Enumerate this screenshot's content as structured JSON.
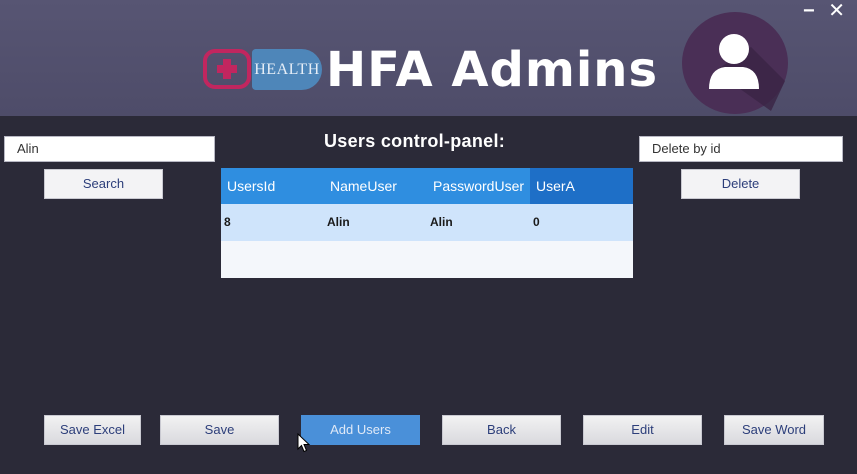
{
  "window": {
    "minimize_glyph": "−",
    "close_glyph": "✕"
  },
  "header": {
    "logo_text": "HEALTH",
    "title": "HFA Admins",
    "avatar_icon": "user-icon"
  },
  "search": {
    "input_value": "Alin",
    "button_label": "Search"
  },
  "panel": {
    "title": "Users control-panel:"
  },
  "delete": {
    "input_value": "Delete by id",
    "button_label": "Delete"
  },
  "table": {
    "columns": [
      "UsersId",
      "NameUser",
      "PasswordUser",
      "UserA"
    ],
    "rows": [
      {
        "UsersId": "8",
        "NameUser": "Alin",
        "PasswordUser": "Alin",
        "UserA": "0"
      }
    ]
  },
  "actions": {
    "save_excel": "Save Excel",
    "save": "Save",
    "add_users": "Add Users",
    "back": "Back",
    "edit": "Edit",
    "save_word": "Save Word"
  },
  "colors": {
    "header_bg": "#575573",
    "body_bg": "#2b2a38",
    "grid_header": "#2f8ee0",
    "grid_selected_row": "#cfe4fb",
    "accent_blue_button": "#4a90d9",
    "logo_pink": "#c1265f"
  }
}
